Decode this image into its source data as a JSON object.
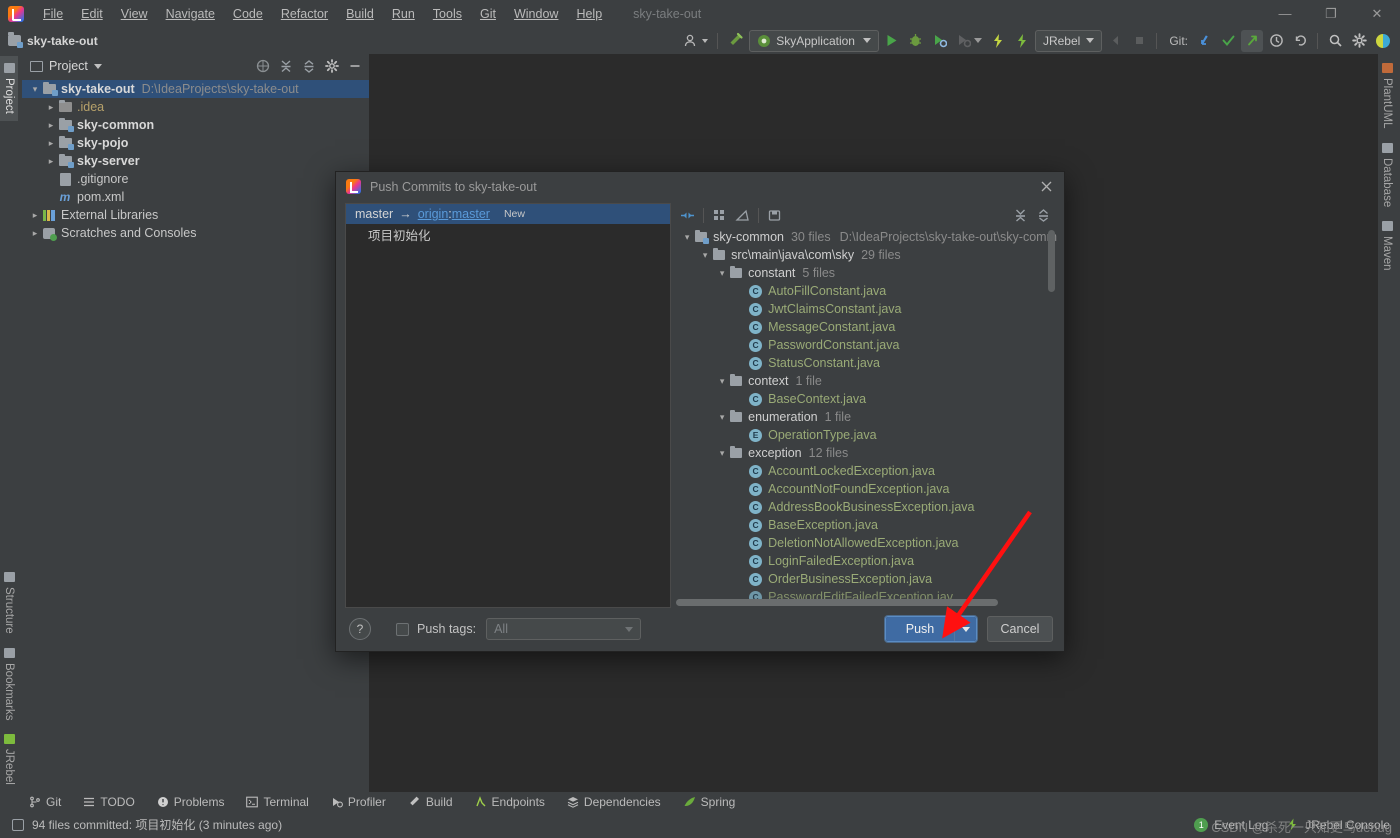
{
  "window": {
    "app_icon": "intellij-logo-icon",
    "project_title": "sky-take-out",
    "minimize": "—",
    "maximize": "❐",
    "close": "✕"
  },
  "menubar": {
    "items": [
      {
        "label": "File"
      },
      {
        "label": "Edit"
      },
      {
        "label": "View"
      },
      {
        "label": "Navigate"
      },
      {
        "label": "Code"
      },
      {
        "label": "Refactor"
      },
      {
        "label": "Build"
      },
      {
        "label": "Run"
      },
      {
        "label": "Tools"
      },
      {
        "label": "Git"
      },
      {
        "label": "Window"
      },
      {
        "label": "Help"
      }
    ]
  },
  "navbar": {
    "project_label": "sky-take-out",
    "run_config": "SkyApplication",
    "jrebel_label": "JRebel",
    "git_label": "Git:",
    "icons": {
      "user": "user-avatar-icon",
      "hammer": "build-hammer-icon",
      "run": "run-icon",
      "debug": "debug-icon",
      "coverage": "run-with-coverage-icon",
      "profile": "profiler-icon",
      "jrebel_run": "jrebel-run-icon",
      "jrebel_debug": "jrebel-debug-icon",
      "stop": "stop-icon",
      "update": "git-update-icon",
      "commit": "git-commit-icon",
      "push": "git-push-icon",
      "history": "history-icon",
      "rollback": "rollback-icon",
      "search": "search-everywhere-icon",
      "settings": "settings-gear-icon",
      "account": "account-icon"
    }
  },
  "left_strip": {
    "top": [
      {
        "label": "Project",
        "icon": "project-folder-icon",
        "selected": true
      }
    ],
    "bottom": [
      {
        "label": "Structure",
        "icon": "structure-icon"
      },
      {
        "label": "Bookmarks",
        "icon": "bookmarks-icon"
      },
      {
        "label": "JRebel",
        "icon": "jrebel-icon"
      }
    ]
  },
  "right_strip": {
    "items": [
      {
        "label": "PlantUML",
        "icon": "plantuml-icon"
      },
      {
        "label": "Database",
        "icon": "database-icon"
      },
      {
        "label": "Maven",
        "icon": "maven-icon"
      }
    ]
  },
  "project_panel": {
    "title": "Project",
    "header_icons": [
      {
        "name": "select-opened-file-icon"
      },
      {
        "name": "expand-all-icon"
      },
      {
        "name": "collapse-all-icon"
      },
      {
        "name": "settings-gear-icon"
      },
      {
        "name": "hide-icon"
      }
    ],
    "tree": [
      {
        "label": "sky-take-out",
        "path": "D:\\IdeaProjects\\sky-take-out",
        "indent": 0,
        "arrow": "open",
        "icon": "module-folder-icon",
        "bold": true,
        "selected": true
      },
      {
        "label": ".idea",
        "indent": 1,
        "arrow": "closed",
        "icon": "folder-icon-yellow",
        "bold": false,
        "muted": true
      },
      {
        "label": "sky-common",
        "indent": 1,
        "arrow": "closed",
        "icon": "module-folder-icon",
        "bold": true
      },
      {
        "label": "sky-pojo",
        "indent": 1,
        "arrow": "closed",
        "icon": "module-folder-icon",
        "bold": true
      },
      {
        "label": "sky-server",
        "indent": 1,
        "arrow": "closed",
        "icon": "module-folder-icon",
        "bold": true
      },
      {
        "label": ".gitignore",
        "indent": 1,
        "arrow": "none",
        "icon": "gitignore-file-icon",
        "bold": false
      },
      {
        "label": "pom.xml",
        "indent": 1,
        "arrow": "none",
        "icon": "maven-pom-icon",
        "bold": false
      },
      {
        "label": "External Libraries",
        "indent": 0,
        "arrow": "closed",
        "icon": "libraries-icon",
        "bold": false
      },
      {
        "label": "Scratches and Consoles",
        "indent": 0,
        "arrow": "closed",
        "icon": "scratches-icon",
        "bold": false
      }
    ]
  },
  "dialog": {
    "title": "Push Commits to sky-take-out",
    "close_icon": "close-icon",
    "branch": {
      "local": "master",
      "arrow": "→",
      "remote": "origin",
      "colon": " : ",
      "remote_branch": "master",
      "badge": "New"
    },
    "commit_message": "项目初始化",
    "files_toolbar": [
      {
        "name": "expand-collapse-diff-icon"
      },
      {
        "name": "group-by-icon"
      },
      {
        "name": "edit-icon"
      },
      {
        "name": "save-icon"
      },
      {
        "name": "expand-all-icon"
      },
      {
        "name": "collapse-all-icon"
      }
    ],
    "files_tree": [
      {
        "indent": 0,
        "arrow": "open",
        "type": "module",
        "label": "sky-common",
        "count": "30 files",
        "path": "D:\\IdeaProjects\\sky-take-out\\sky-comm"
      },
      {
        "indent": 1,
        "arrow": "open",
        "type": "folder",
        "label": "src\\main\\java\\com\\sky",
        "count": "29 files"
      },
      {
        "indent": 2,
        "arrow": "open",
        "type": "folder",
        "label": "constant",
        "count": "5 files"
      },
      {
        "indent": 3,
        "arrow": "none",
        "type": "class",
        "label": "AutoFillConstant.java"
      },
      {
        "indent": 3,
        "arrow": "none",
        "type": "class",
        "label": "JwtClaimsConstant.java"
      },
      {
        "indent": 3,
        "arrow": "none",
        "type": "class",
        "label": "MessageConstant.java"
      },
      {
        "indent": 3,
        "arrow": "none",
        "type": "class",
        "label": "PasswordConstant.java"
      },
      {
        "indent": 3,
        "arrow": "none",
        "type": "class",
        "label": "StatusConstant.java"
      },
      {
        "indent": 2,
        "arrow": "open",
        "type": "folder",
        "label": "context",
        "count": "1 file"
      },
      {
        "indent": 3,
        "arrow": "none",
        "type": "class",
        "label": "BaseContext.java"
      },
      {
        "indent": 2,
        "arrow": "open",
        "type": "folder",
        "label": "enumeration",
        "count": "1 file"
      },
      {
        "indent": 3,
        "arrow": "none",
        "type": "enum",
        "label": "OperationType.java"
      },
      {
        "indent": 2,
        "arrow": "open",
        "type": "folder",
        "label": "exception",
        "count": "12 files"
      },
      {
        "indent": 3,
        "arrow": "none",
        "type": "class",
        "label": "AccountLockedException.java"
      },
      {
        "indent": 3,
        "arrow": "none",
        "type": "class",
        "label": "AccountNotFoundException.java"
      },
      {
        "indent": 3,
        "arrow": "none",
        "type": "class",
        "label": "AddressBookBusinessException.java"
      },
      {
        "indent": 3,
        "arrow": "none",
        "type": "class",
        "label": "BaseException.java"
      },
      {
        "indent": 3,
        "arrow": "none",
        "type": "class",
        "label": "DeletionNotAllowedException.java"
      },
      {
        "indent": 3,
        "arrow": "none",
        "type": "class",
        "label": "LoginFailedException.java"
      },
      {
        "indent": 3,
        "arrow": "none",
        "type": "class",
        "label": "OrderBusinessException.java"
      },
      {
        "indent": 3,
        "arrow": "none",
        "type": "class",
        "label": "PasswordEditFailedException.jav"
      }
    ],
    "footer": {
      "help_label": "?",
      "push_tags_label": "Push tags:",
      "push_tags_checked": false,
      "tags_value": "All",
      "push_label": "Push",
      "push_mnemonic": "P",
      "cancel_label": "Cancel"
    }
  },
  "bottom_tabs": [
    {
      "label": "Git",
      "icon": "git-branch-icon"
    },
    {
      "label": "TODO",
      "icon": "todo-list-icon"
    },
    {
      "label": "Problems",
      "icon": "problems-icon"
    },
    {
      "label": "Terminal",
      "icon": "terminal-icon"
    },
    {
      "label": "Profiler",
      "icon": "profiler-icon"
    },
    {
      "label": "Build",
      "icon": "build-hammer-icon"
    },
    {
      "label": "Endpoints",
      "icon": "endpoints-icon"
    },
    {
      "label": "Dependencies",
      "icon": "dependencies-icon"
    },
    {
      "label": "Spring",
      "icon": "spring-leaf-icon"
    }
  ],
  "statusbar": {
    "message": "94 files committed: 项目初始化 (3 minutes ago)",
    "event_log": "Event Log",
    "event_count": "1",
    "jrebel_console": "JRebel Console",
    "watermark": "CSDN @杀死一只知更鸟debug"
  },
  "colors": {
    "accent_blue": "#3f6ba3",
    "selection_blue": "#2f5079",
    "link_blue": "#5a9ad9",
    "java_green": "#9aab77",
    "annotation_red": "#ff0000"
  }
}
